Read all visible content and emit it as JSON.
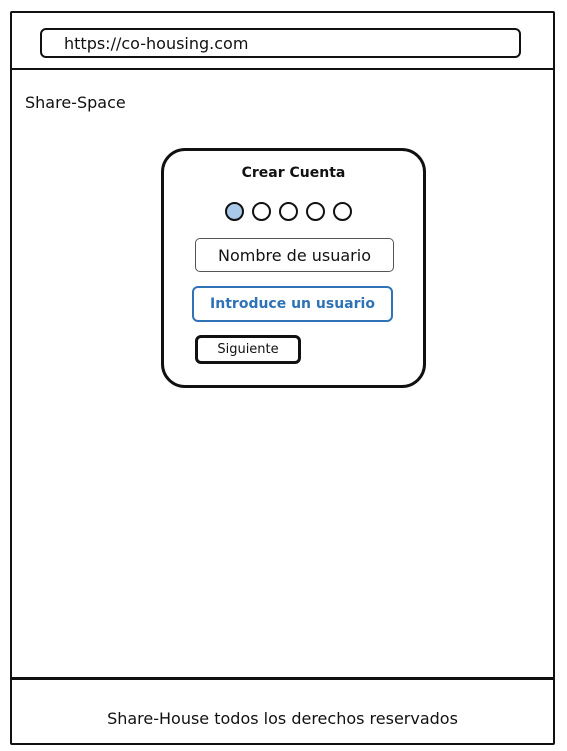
{
  "browser": {
    "url": "https://co-housing.com"
  },
  "header": {
    "brand": "Share-Space"
  },
  "signup_card": {
    "title": "Crear Cuenta",
    "steps": {
      "total": 5,
      "current": 1
    },
    "username_placeholder": "Nombre de usuario",
    "hint": "Introduce un usuario",
    "next_label": "Siguiente"
  },
  "footer": {
    "text": "Share-House todos los derechos reservados"
  },
  "colors": {
    "accent": "#2f73b7",
    "active_step": "#a9c9ea"
  }
}
